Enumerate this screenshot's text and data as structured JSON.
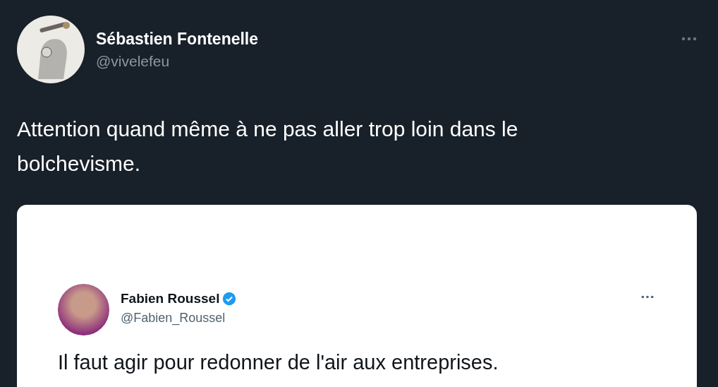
{
  "tweet": {
    "author": {
      "name": "Sébastien Fontenelle",
      "handle": "@vivelefeu"
    },
    "text": "Attention quand même à ne pas aller trop loin dans le bolchevisme.",
    "quoted": {
      "author": {
        "name": "Fabien Roussel",
        "handle": "@Fabien_Roussel",
        "verified": true
      },
      "text": "Il faut agir pour redonner de l'air aux entreprises."
    }
  }
}
